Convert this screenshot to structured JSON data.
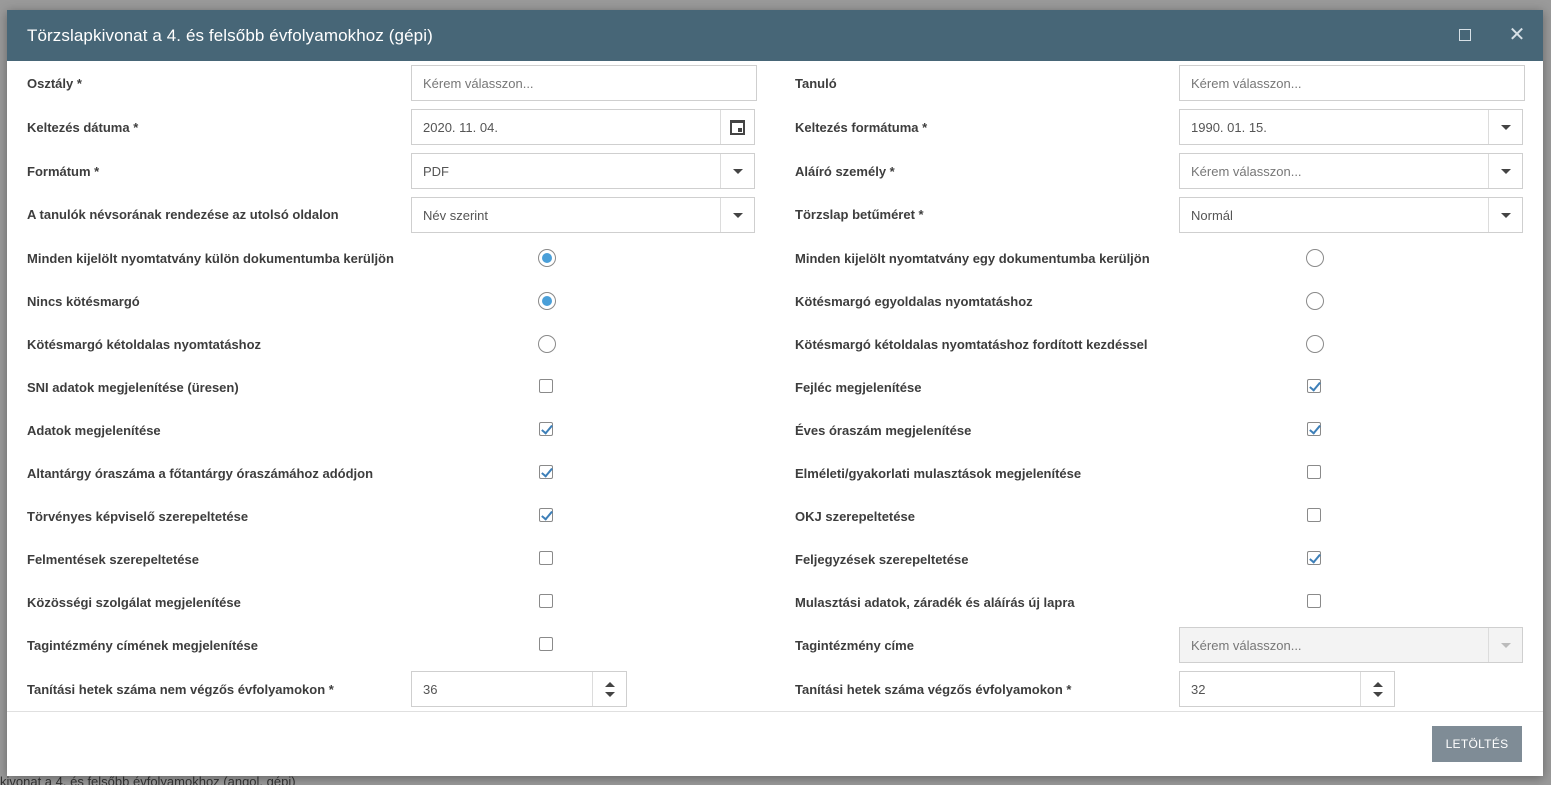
{
  "background": {
    "bottom_text": "kivonat a 4. és felsőbb évfolyamokhoz (angol, gépi)"
  },
  "dialog": {
    "title": "Törzslapkivonat a 4. és felsőbb évfolyamokhoz (gépi)",
    "header_color": "#476677",
    "maximize_icon": "maximize-icon",
    "close_icon": "close-icon"
  },
  "fields": {
    "osztaly": {
      "label": "Osztály *",
      "value": "Kérem válasszon..."
    },
    "tanulo": {
      "label": "Tanuló",
      "value": "Kérem válasszon..."
    },
    "keltezes_datuma": {
      "label": "Keltezés dátuma *",
      "value": "2020. 11. 04."
    },
    "keltezes_formatuma": {
      "label": "Keltezés formátuma *",
      "value": "1990. 01. 15."
    },
    "formatum": {
      "label": "Formátum *",
      "value": "PDF"
    },
    "alairo": {
      "label": "Aláíró személy *",
      "value": "Kérem válasszon..."
    },
    "rendezes": {
      "label": "A tanulók névsorának rendezése az utolsó oldalon",
      "value": "Név szerint"
    },
    "betumeret": {
      "label": "Törzslap betűméret *",
      "value": "Normál"
    },
    "tagintezmeny_cime": {
      "label": "Tagintézmény címe",
      "value": "Kérem válasszon..."
    },
    "hetek_nem_vegzos": {
      "label": "Tanítási hetek száma nem végzős évfolyamokon *",
      "value": "36"
    },
    "hetek_vegzos": {
      "label": "Tanítási hetek száma végzős évfolyamokon *",
      "value": "32"
    }
  },
  "options": {
    "kulon_dok": {
      "label": "Minden kijelölt nyomtatvány külön dokumentumba kerüljön",
      "checked": true
    },
    "egy_dok": {
      "label": "Minden kijelölt nyomtatvány egy dokumentumba kerüljön",
      "checked": false
    },
    "nincs_margo": {
      "label": "Nincs kötésmargó",
      "checked": true
    },
    "margo_egyoldalas": {
      "label": "Kötésmargó egyoldalas nyomtatáshoz",
      "checked": false
    },
    "margo_ketoldalas": {
      "label": "Kötésmargó kétoldalas nyomtatáshoz",
      "checked": false
    },
    "margo_ketoldalas_forditott": {
      "label": "Kötésmargó kétoldalas nyomtatáshoz fordított kezdéssel",
      "checked": false
    },
    "sni": {
      "label": "SNI adatok megjelenítése (üresen)",
      "checked": false
    },
    "fejlec": {
      "label": "Fejléc megjelenítése",
      "checked": true
    },
    "adatok": {
      "label": "Adatok megjelenítése",
      "checked": true
    },
    "eves_oraszam": {
      "label": "Éves óraszám megjelenítése",
      "checked": true
    },
    "altantargy": {
      "label": "Altantárgy óraszáma a főtantárgy óraszámához adódjon",
      "checked": true
    },
    "elmeleti": {
      "label": "Elméleti/gyakorlati mulasztások megjelenítése",
      "checked": false
    },
    "torvenyes": {
      "label": "Törvényes képviselő szerepeltetése",
      "checked": true
    },
    "okj": {
      "label": "OKJ szerepeltetése",
      "checked": false
    },
    "felmentesek": {
      "label": "Felmentések szerepeltetése",
      "checked": false
    },
    "feljegyzesek": {
      "label": "Feljegyzések szerepeltetése",
      "checked": true
    },
    "kozossegi": {
      "label": "Közösségi szolgálat megjelenítése",
      "checked": false
    },
    "mulasztasi": {
      "label": "Mulasztási adatok, záradék és aláírás új lapra",
      "checked": false
    },
    "tagintezmeny_cimenek": {
      "label": "Tagintézmény címének megjelenítése",
      "checked": false
    }
  },
  "footer": {
    "download_label": "LETÖLTÉS"
  }
}
